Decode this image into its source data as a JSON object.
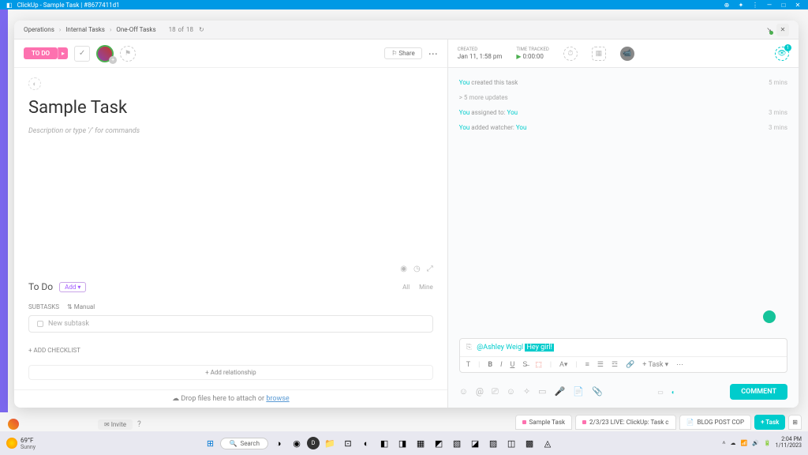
{
  "browser": {
    "title": "ClickUp - Sample Task | #8677411d1"
  },
  "breadcrumbs": [
    "Operations",
    "Internal Tasks",
    "One-Off Tasks"
  ],
  "task_nav": {
    "current": "18",
    "of": "of",
    "total": "18"
  },
  "status_button": "TO DO",
  "share_button": "⚐ Share",
  "task": {
    "title": "Sample Task",
    "description_placeholder": "Description or type '/' for commands"
  },
  "right_meta": {
    "created_label": "CREATED",
    "created_val": "Jan 11, 1:58 pm",
    "tracked_label": "TIME TRACKED",
    "tracked_val": "0:00:00"
  },
  "watch_count": "1",
  "activity": {
    "row1_you": "You",
    "row1_text": " created this task",
    "row1_time": "5 mins",
    "more": "> 5 more updates",
    "row2_you": "You",
    "row2_text": " assigned to: ",
    "row2_target": "You",
    "row2_time": "3 mins",
    "row3_you": "You",
    "row3_text": " added watcher: ",
    "row3_target": "You",
    "row3_time": "3 mins"
  },
  "todo": {
    "label": "To Do",
    "add": "Add ▾",
    "filter_all": "All",
    "filter_mine": "Mine"
  },
  "subtasks": {
    "header": "SUBTASKS",
    "manual": "⇅ Manual",
    "placeholder": "New subtask"
  },
  "checklist": "+ ADD CHECKLIST",
  "relationship": "+ Add relationship",
  "dropfiles": {
    "text": "Drop files here to attach or ",
    "link": "browse"
  },
  "comment": {
    "mention": "@Ashley Weigl",
    "highlighted": "Hey girl!",
    "task_btn": "+ Task ▾",
    "button": "COMMENT"
  },
  "bottom_tabs": {
    "tab1": "Sample Task",
    "tab2": "2/3/23 LIVE: ClickUp: Task c",
    "tab3": "BLOG POST COP",
    "new_task": "+ Task"
  },
  "bg": {
    "invite": "✉ Invite"
  },
  "taskbar": {
    "temp": "69°F",
    "cond": "Sunny",
    "search": "Search",
    "time": "2:04 PM",
    "date": "1/11/2023"
  }
}
